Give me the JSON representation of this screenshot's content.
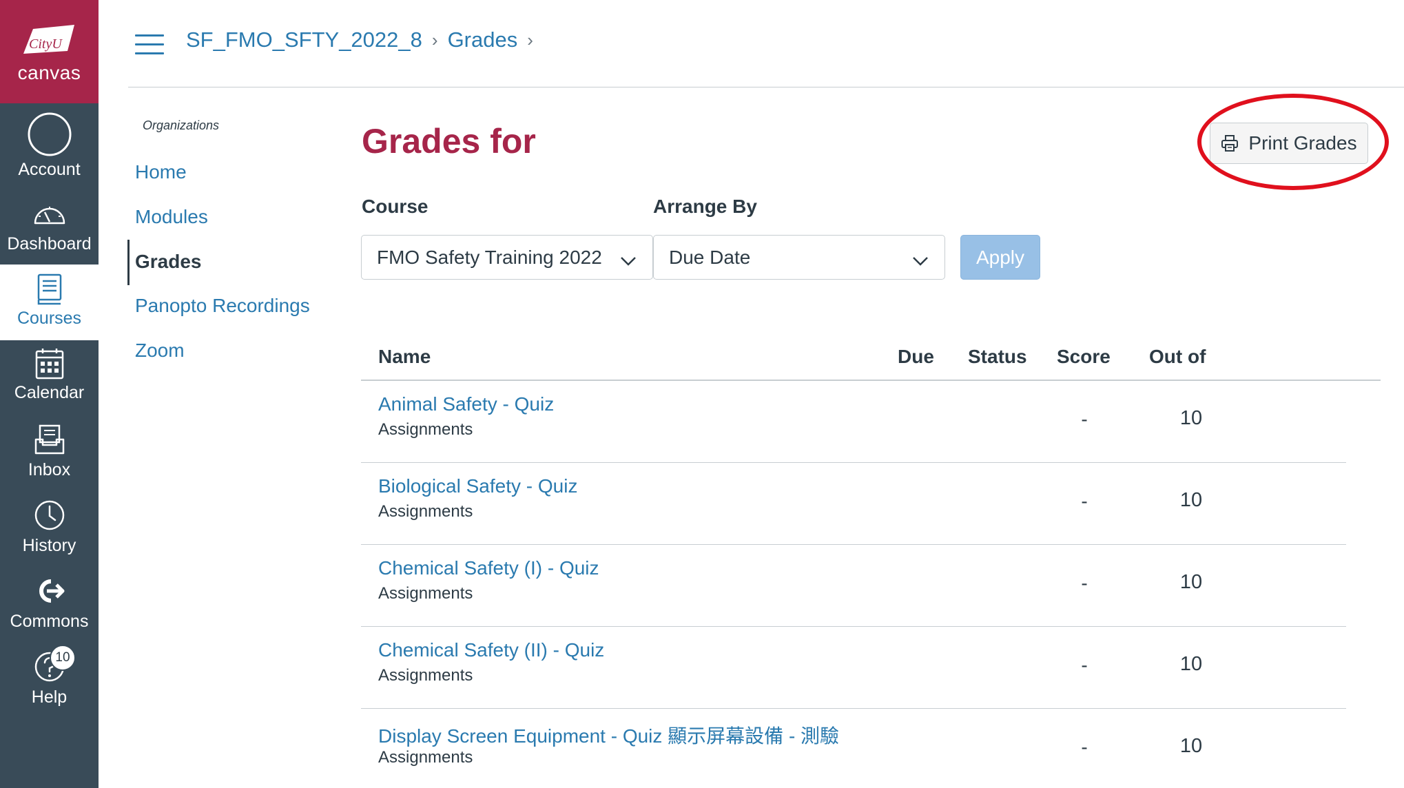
{
  "brand": {
    "logo_badge_text": "CityU",
    "logo_text": "canvas",
    "primary_color": "#a6254a",
    "nav_bg_color": "#394b58",
    "link_color": "#2a7aaf"
  },
  "global_nav": {
    "items": [
      {
        "label": "Account",
        "icon": "account-circle-icon"
      },
      {
        "label": "Dashboard",
        "icon": "dashboard-gauge-icon"
      },
      {
        "label": "Courses",
        "icon": "courses-book-icon",
        "active": true
      },
      {
        "label": "Calendar",
        "icon": "calendar-icon"
      },
      {
        "label": "Inbox",
        "icon": "inbox-icon"
      },
      {
        "label": "History",
        "icon": "history-clock-icon"
      },
      {
        "label": "Commons",
        "icon": "commons-icon"
      },
      {
        "label": "Help",
        "icon": "help-icon",
        "badge": "10"
      }
    ]
  },
  "breadcrumb": {
    "course": "SF_FMO_SFTY_2022_8",
    "page": "Grades",
    "separator": "›"
  },
  "course_nav": {
    "title": "Organizations",
    "items": [
      {
        "label": "Home"
      },
      {
        "label": "Modules"
      },
      {
        "label": "Grades",
        "active": true
      },
      {
        "label": "Panopto Recordings"
      },
      {
        "label": "Zoom"
      }
    ]
  },
  "main": {
    "title": "Grades for",
    "print_button": "Print Grades",
    "course_label": "Course",
    "course_value": "FMO Safety Training 2022",
    "arrange_label": "Arrange By",
    "arrange_value": "Due Date",
    "apply_button": "Apply"
  },
  "table": {
    "headers": [
      "Name",
      "Due",
      "Status",
      "Score",
      "Out of"
    ],
    "rows": [
      {
        "name": "Animal Safety - Quiz",
        "group": "Assignments",
        "due": "",
        "status": "",
        "score": "-",
        "out_of": "10"
      },
      {
        "name": "Biological Safety - Quiz",
        "group": "Assignments",
        "due": "",
        "status": "",
        "score": "-",
        "out_of": "10"
      },
      {
        "name": "Chemical Safety (I) - Quiz",
        "group": "Assignments",
        "due": "",
        "status": "",
        "score": "-",
        "out_of": "10"
      },
      {
        "name": "Chemical Safety (II) - Quiz",
        "group": "Assignments",
        "due": "",
        "status": "",
        "score": "-",
        "out_of": "10"
      },
      {
        "name": "Display Screen Equipment - Quiz 顯示屏幕設備 - 測驗",
        "group": "Assignments",
        "due": "",
        "status": "",
        "score": "-",
        "out_of": "10"
      }
    ]
  }
}
